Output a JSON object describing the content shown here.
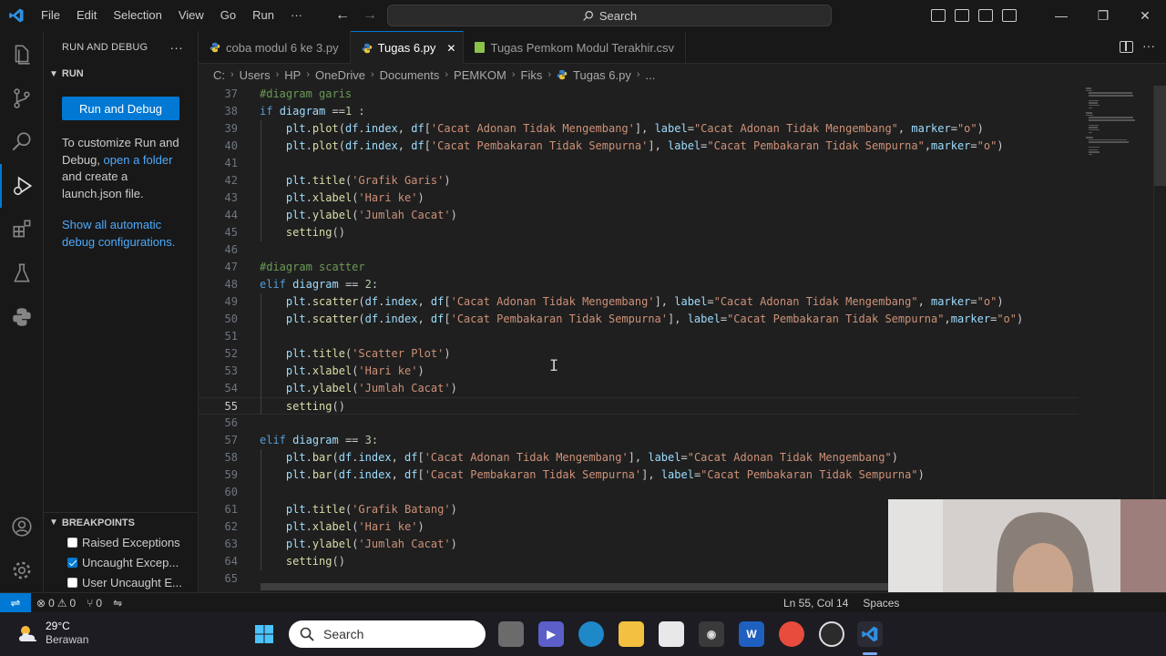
{
  "menu": [
    "File",
    "Edit",
    "Selection",
    "View",
    "Go",
    "Run",
    "···"
  ],
  "search": {
    "label": "Search"
  },
  "sidebar": {
    "header": "RUN AND DEBUG",
    "more": "···",
    "section": "RUN",
    "run_button": "Run and Debug",
    "text1": "To customize Run and Debug, ",
    "link1": "open a folder",
    "text2": " and create a launch.json file.",
    "link2": "Show all automatic debug configurations.",
    "breakpoints_header": "BREAKPOINTS",
    "breakpoints": [
      {
        "label": "Raised Exceptions",
        "checked": false
      },
      {
        "label": "Uncaught Excep...",
        "checked": true
      },
      {
        "label": "User Uncaught E...",
        "checked": false
      }
    ]
  },
  "tabs": [
    {
      "label": "coba modul 6 ke 3.py",
      "active": false
    },
    {
      "label": "Tugas 6.py",
      "active": true,
      "close": "✕"
    },
    {
      "label": "Tugas Pemkom Modul Terakhir.csv",
      "active": false
    }
  ],
  "breadcrumb": [
    "C:",
    "Users",
    "HP",
    "OneDrive",
    "Documents",
    "PEMKOM",
    "Fiks",
    "Tugas 6.py",
    "..."
  ],
  "code_lines": [
    {
      "n": "37",
      "html": "<span class='c-com'>#diagram garis</span>"
    },
    {
      "n": "38",
      "html": "<span class='c-kw'>if</span> <span class='c-var'>diagram</span> ==<span class='c-num'>1</span> :"
    },
    {
      "n": "39",
      "html": "    <span class='c-var'>plt</span>.<span class='c-fn'>plot</span>(<span class='c-var'>df</span>.<span class='c-var'>index</span>, <span class='c-var'>df</span>[<span class='c-str'>'Cacat Adonan Tidak Mengembang'</span>], <span class='c-var'>label</span>=<span class='c-str'>\"Cacat Adonan Tidak Mengembang\"</span>, <span class='c-var'>marker</span>=<span class='c-str'>\"o\"</span>)"
    },
    {
      "n": "40",
      "html": "    <span class='c-var'>plt</span>.<span class='c-fn'>plot</span>(<span class='c-var'>df</span>.<span class='c-var'>index</span>, <span class='c-var'>df</span>[<span class='c-str'>'Cacat Pembakaran Tidak Sempurna'</span>], <span class='c-var'>label</span>=<span class='c-str'>\"Cacat Pembakaran Tidak Sempurna\"</span>,<span class='c-var'>marker</span>=<span class='c-str'>\"o\"</span>)"
    },
    {
      "n": "41",
      "html": ""
    },
    {
      "n": "42",
      "html": "    <span class='c-var'>plt</span>.<span class='c-fn'>title</span>(<span class='c-str'>'Grafik Garis'</span>)"
    },
    {
      "n": "43",
      "html": "    <span class='c-var'>plt</span>.<span class='c-fn'>xlabel</span>(<span class='c-str'>'Hari ke'</span>)"
    },
    {
      "n": "44",
      "html": "    <span class='c-var'>plt</span>.<span class='c-fn'>ylabel</span>(<span class='c-str'>'Jumlah Cacat'</span>)"
    },
    {
      "n": "45",
      "html": "    <span class='c-fn'>setting</span>()"
    },
    {
      "n": "46",
      "html": ""
    },
    {
      "n": "47",
      "html": "<span class='c-com'>#diagram scatter</span>"
    },
    {
      "n": "48",
      "html": "<span class='c-kw'>elif</span> <span class='c-var'>diagram</span> == <span class='c-num'>2</span>:"
    },
    {
      "n": "49",
      "html": "    <span class='c-var'>plt</span>.<span class='c-fn'>scatter</span>(<span class='c-var'>df</span>.<span class='c-var'>index</span>, <span class='c-var'>df</span>[<span class='c-str'>'Cacat Adonan Tidak Mengembang'</span>], <span class='c-var'>label</span>=<span class='c-str'>\"Cacat Adonan Tidak Mengembang\"</span>, <span class='c-var'>marker</span>=<span class='c-str'>\"o\"</span>)"
    },
    {
      "n": "50",
      "html": "    <span class='c-var'>plt</span>.<span class='c-fn'>scatter</span>(<span class='c-var'>df</span>.<span class='c-var'>index</span>, <span class='c-var'>df</span>[<span class='c-str'>'Cacat Pembakaran Tidak Sempurna'</span>], <span class='c-var'>label</span>=<span class='c-str'>\"Cacat Pembakaran Tidak Sempurna\"</span>,<span class='c-var'>marker</span>=<span class='c-str'>\"o\"</span>)"
    },
    {
      "n": "51",
      "html": ""
    },
    {
      "n": "52",
      "html": "    <span class='c-var'>plt</span>.<span class='c-fn'>title</span>(<span class='c-str'>'Scatter Plot'</span>)"
    },
    {
      "n": "53",
      "html": "    <span class='c-var'>plt</span>.<span class='c-fn'>xlabel</span>(<span class='c-str'>'Hari ke'</span>)"
    },
    {
      "n": "54",
      "html": "    <span class='c-var'>plt</span>.<span class='c-fn'>ylabel</span>(<span class='c-str'>'Jumlah Cacat'</span>)"
    },
    {
      "n": "55",
      "html": "    <span class='c-fn'>setting</span>()",
      "current": true
    },
    {
      "n": "56",
      "html": ""
    },
    {
      "n": "57",
      "html": "<span class='c-kw'>elif</span> <span class='c-var'>diagram</span> == <span class='c-num'>3</span>:"
    },
    {
      "n": "58",
      "html": "    <span class='c-var'>plt</span>.<span class='c-fn'>bar</span>(<span class='c-var'>df</span>.<span class='c-var'>index</span>, <span class='c-var'>df</span>[<span class='c-str'>'Cacat Adonan Tidak Mengembang'</span>], <span class='c-var'>label</span>=<span class='c-str'>\"Cacat Adonan Tidak Mengembang\"</span>)"
    },
    {
      "n": "59",
      "html": "    <span class='c-var'>plt</span>.<span class='c-fn'>bar</span>(<span class='c-var'>df</span>.<span class='c-var'>index</span>, <span class='c-var'>df</span>[<span class='c-str'>'Cacat Pembakaran Tidak Sempurna'</span>], <span class='c-var'>label</span>=<span class='c-str'>\"Cacat Pembakaran Tidak Sempurna\"</span>)"
    },
    {
      "n": "60",
      "html": ""
    },
    {
      "n": "61",
      "html": "    <span class='c-var'>plt</span>.<span class='c-fn'>title</span>(<span class='c-str'>'Grafik Batang'</span>)"
    },
    {
      "n": "62",
      "html": "    <span class='c-var'>plt</span>.<span class='c-fn'>xlabel</span>(<span class='c-str'>'Hari ke'</span>)"
    },
    {
      "n": "63",
      "html": "    <span class='c-var'>plt</span>.<span class='c-fn'>ylabel</span>(<span class='c-str'>'Jumlah Cacat'</span>)"
    },
    {
      "n": "64",
      "html": "    <span class='c-fn'>setting</span>()"
    },
    {
      "n": "65",
      "html": ""
    }
  ],
  "status": {
    "errors": "0",
    "warnings": "0",
    "ports": "0",
    "position": "Ln 55, Col 14",
    "spaces": "Spaces"
  },
  "taskbar": {
    "temp": "29°C",
    "weather": "Berawan",
    "search": "Search"
  },
  "colors": {
    "accent": "#0078d4",
    "link": "#4daafc"
  }
}
